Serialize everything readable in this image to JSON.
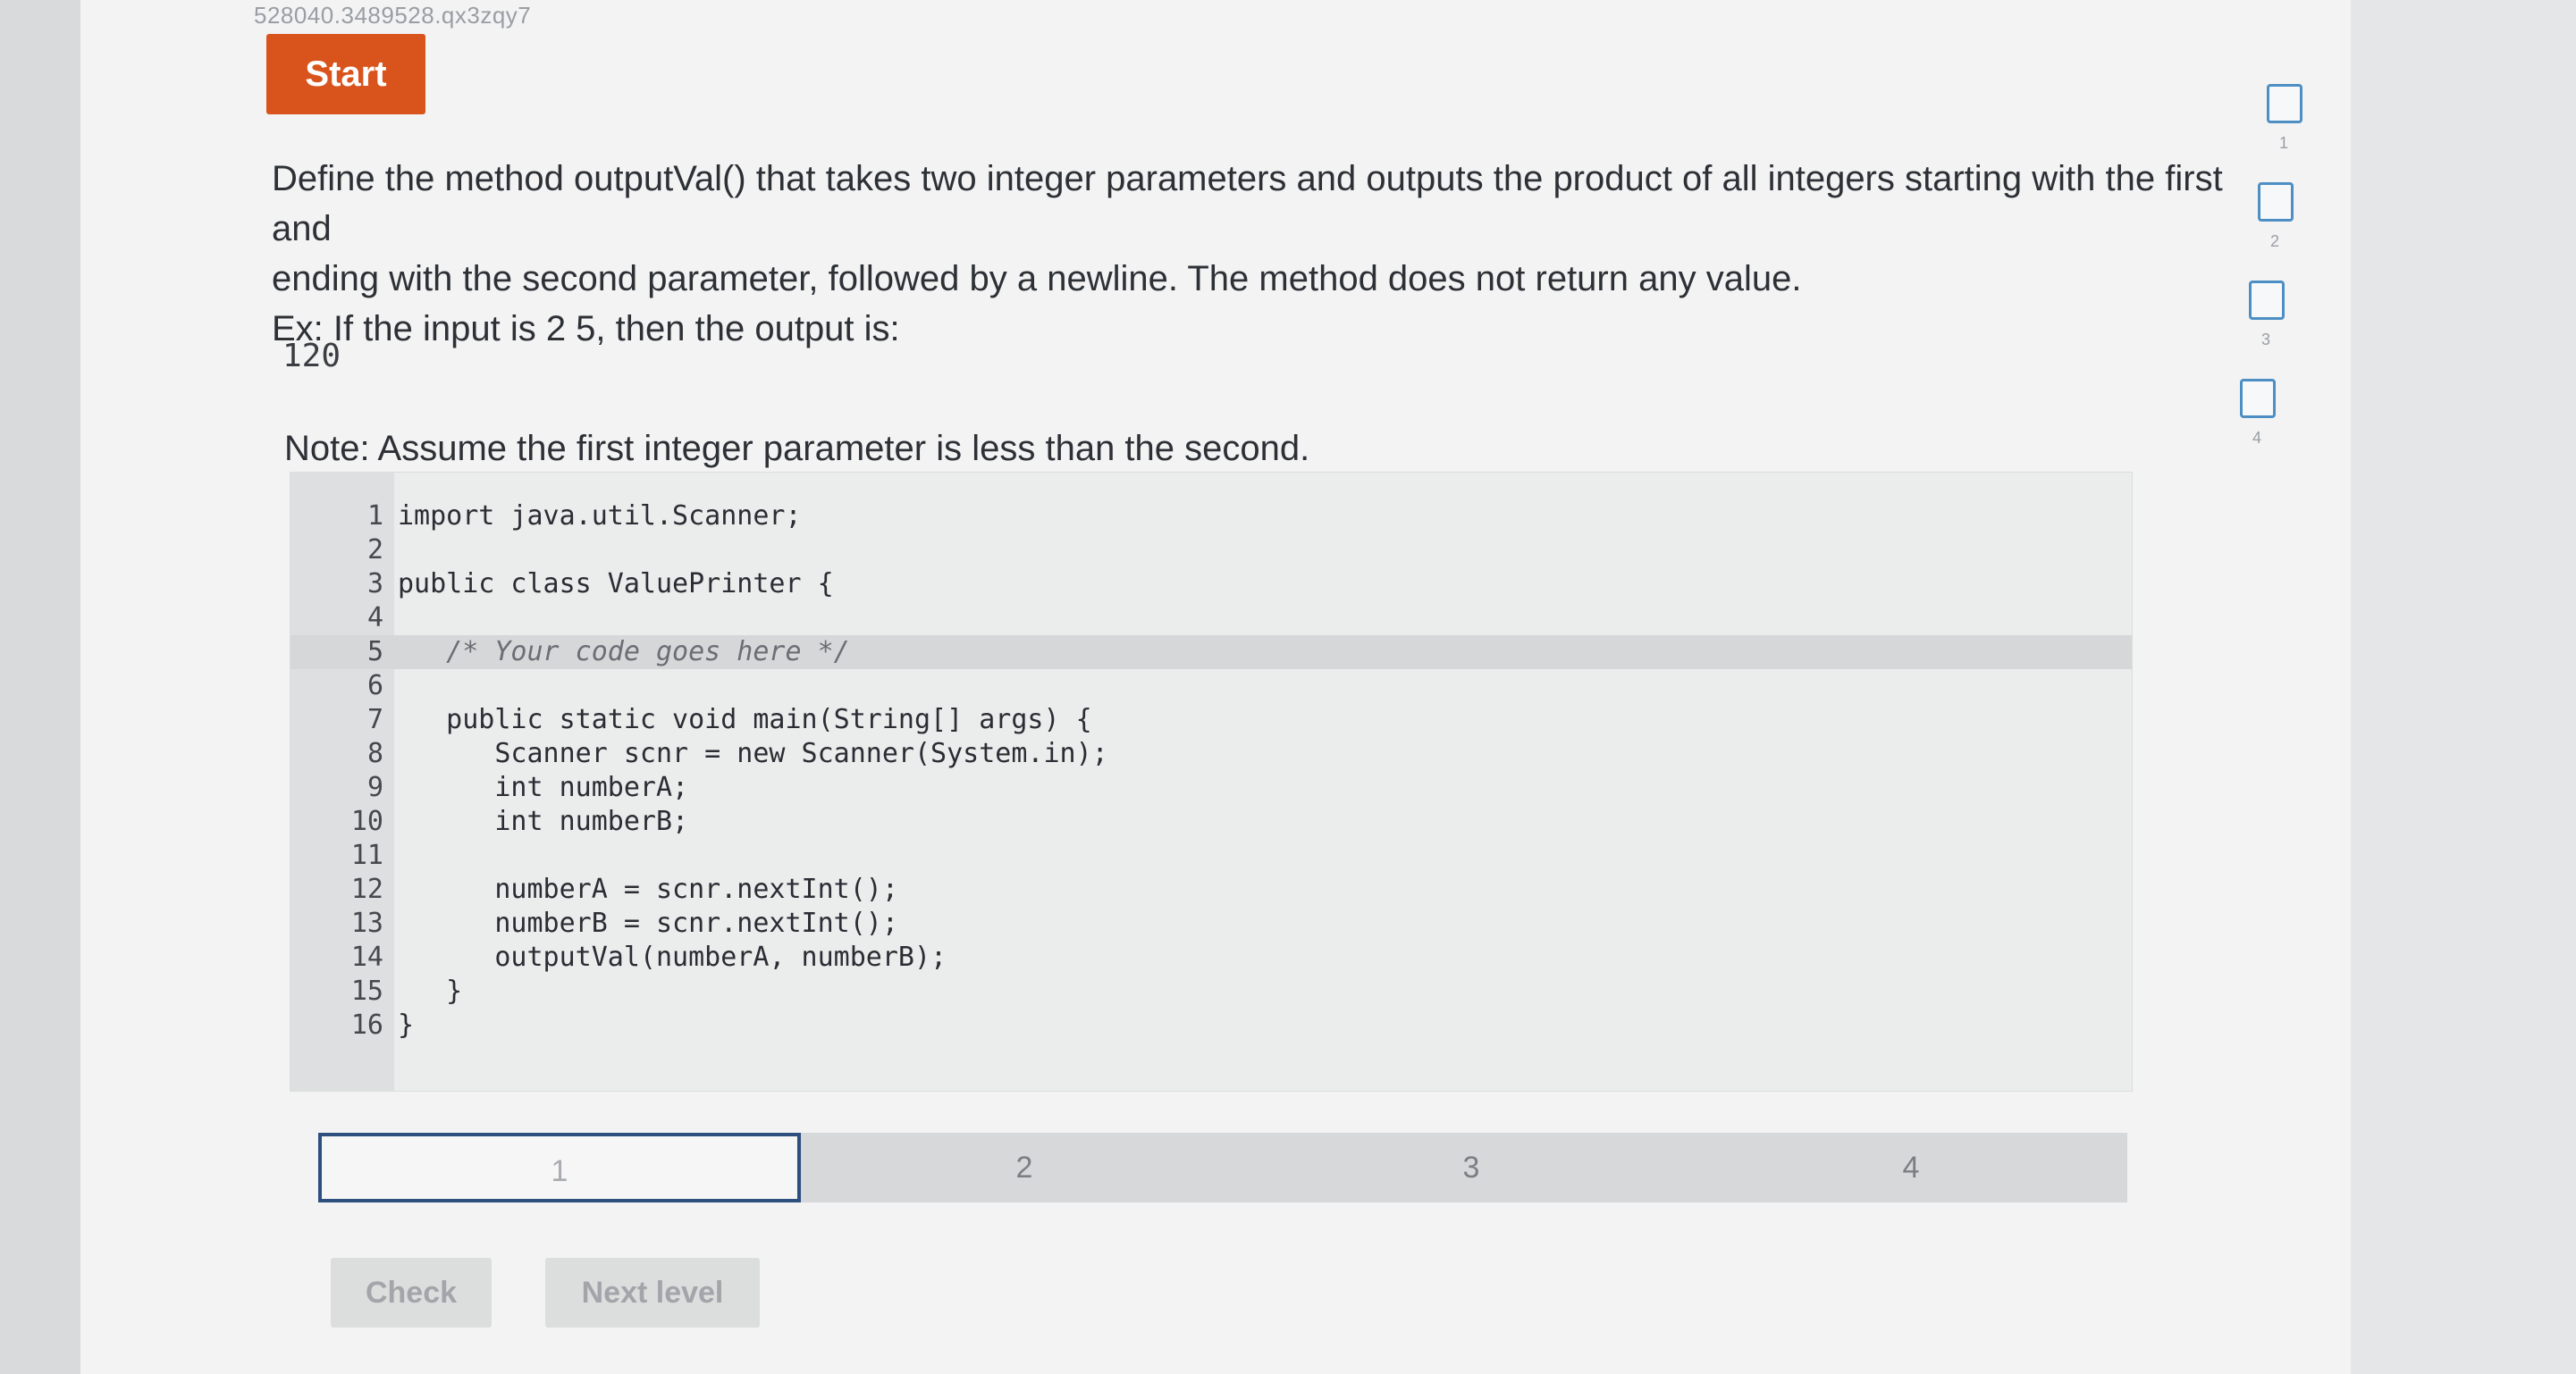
{
  "session_id": "528040.3489528.qx3zqy7",
  "start_label": "Start",
  "prompt": {
    "line1": "Define the method outputVal() that takes two integer parameters and outputs the product of all integers starting with the first and",
    "line2": "ending with the second parameter, followed by a newline. The method does not return any value.",
    "line3": "Ex: If the input is 2 5, then the output is:"
  },
  "output_example": "120",
  "note": "Note: Assume the first integer parameter is less than the second.",
  "code": [
    {
      "num": "1",
      "text": "import java.util.Scanner;"
    },
    {
      "num": "2",
      "text": ""
    },
    {
      "num": "3",
      "text": "public class ValuePrinter {"
    },
    {
      "num": "4",
      "text": ""
    },
    {
      "num": "5",
      "text": "   /* Your code goes here */"
    },
    {
      "num": "6",
      "text": ""
    },
    {
      "num": "7",
      "text": "   public static void main(String[] args) {"
    },
    {
      "num": "8",
      "text": "      Scanner scnr = new Scanner(System.in);"
    },
    {
      "num": "9",
      "text": "      int numberA;"
    },
    {
      "num": "10",
      "text": "      int numberB;"
    },
    {
      "num": "11",
      "text": ""
    },
    {
      "num": "12",
      "text": "      numberA = scnr.nextInt();"
    },
    {
      "num": "13",
      "text": "      numberB = scnr.nextInt();"
    },
    {
      "num": "14",
      "text": "      outputVal(numberA, numberB);"
    },
    {
      "num": "15",
      "text": "   }"
    },
    {
      "num": "16",
      "text": "}"
    }
  ],
  "tabs": [
    "1",
    "2",
    "3",
    "4"
  ],
  "active_tab": "1",
  "check_label": "Check",
  "next_label": "Next level",
  "progress_steps": [
    "1",
    "2",
    "3",
    "4"
  ],
  "colors": {
    "start_button": "#d9541d",
    "active_tab_border": "#2c4f7e",
    "step_box_border": "#4d8fc4"
  }
}
